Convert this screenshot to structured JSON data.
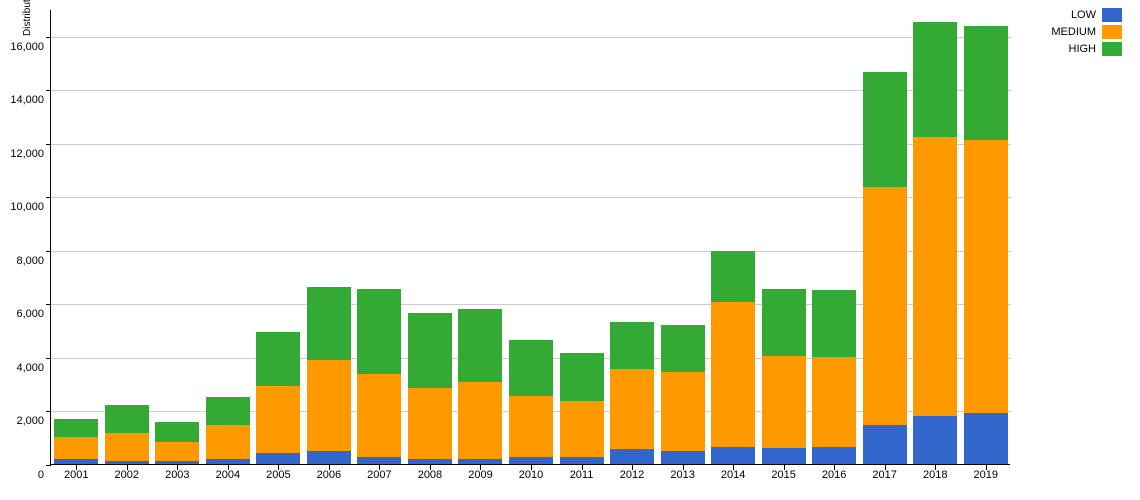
{
  "chart_data": {
    "type": "bar",
    "stacked": true,
    "ylabel": "Distribution",
    "xlabel": "",
    "ylim": [
      0,
      17000
    ],
    "y_ticks": [
      0,
      2000,
      4000,
      6000,
      8000,
      10000,
      12000,
      14000,
      16000
    ],
    "y_tick_labels": [
      "0",
      "2,000",
      "4,000",
      "6,000",
      "8,000",
      "10,000",
      "12,000",
      "14,000",
      "16,000"
    ],
    "categories": [
      "2001",
      "2002",
      "2003",
      "2004",
      "2005",
      "2006",
      "2007",
      "2008",
      "2009",
      "2010",
      "2011",
      "2012",
      "2013",
      "2014",
      "2015",
      "2016",
      "2017",
      "2018",
      "2019"
    ],
    "series": [
      {
        "name": "LOW",
        "color": "#3366cc",
        "values": [
          180,
          100,
          120,
          200,
          400,
          500,
          250,
          200,
          200,
          250,
          250,
          550,
          500,
          650,
          600,
          650,
          1450,
          1800,
          1900
        ]
      },
      {
        "name": "MEDIUM",
        "color": "#ff9900",
        "values": [
          820,
          1050,
          700,
          1250,
          2500,
          3400,
          3100,
          2650,
          2850,
          2300,
          2100,
          3000,
          2950,
          5400,
          3450,
          3350,
          8900,
          10400,
          10200
        ]
      },
      {
        "name": "HIGH",
        "color": "#33aa33",
        "values": [
          700,
          1050,
          750,
          1050,
          2050,
          2700,
          3200,
          2800,
          2750,
          2100,
          1800,
          1750,
          1750,
          1900,
          2500,
          2500,
          4300,
          4300,
          4250
        ]
      }
    ]
  },
  "legend": [
    {
      "name": "LOW",
      "color": "#3366cc"
    },
    {
      "name": "MEDIUM",
      "color": "#ff9900"
    },
    {
      "name": "HIGH",
      "color": "#33aa33"
    }
  ]
}
